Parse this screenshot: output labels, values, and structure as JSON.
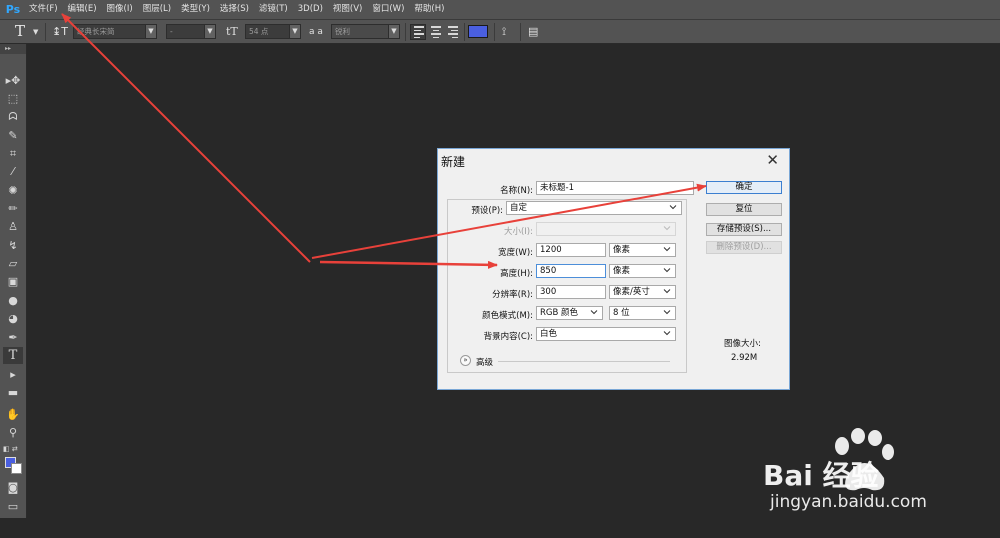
{
  "app": {
    "logo": "Ps"
  },
  "menu": [
    "文件(F)",
    "编辑(E)",
    "图像(I)",
    "图层(L)",
    "类型(Y)",
    "选择(S)",
    "滤镜(T)",
    "3D(D)",
    "视图(V)",
    "窗口(W)",
    "帮助(H)"
  ],
  "options": {
    "tool_glyph": "T",
    "font_family": "经典长宋简",
    "font_style": "-",
    "font_size": "54 点",
    "aa_label": "a a",
    "antialias": "锐利",
    "text_color": "#4a5fe0"
  },
  "tools": {
    "head": "▸▸",
    "foreground": "#4a5fe0",
    "background": "#ffffff"
  },
  "dialog": {
    "title": "新建",
    "name_label": "名称(N):",
    "name_value": "未标题-1",
    "preset_label": "预设(P):",
    "preset_value": "自定",
    "size_label": "大小(I):",
    "size_value": "",
    "width_label": "宽度(W):",
    "width_value": "1200",
    "width_unit": "像素",
    "height_label": "高度(H):",
    "height_value": "850",
    "height_unit": "像素",
    "res_label": "分辨率(R):",
    "res_value": "300",
    "res_unit": "像素/英寸",
    "mode_label": "颜色模式(M):",
    "mode_value": "RGB 颜色",
    "depth_value": "8 位",
    "bg_label": "背景内容(C):",
    "bg_value": "白色",
    "advanced_label": "高级",
    "btn_ok": "确定",
    "btn_reset": "复位",
    "btn_save": "存储预设(S)...",
    "btn_delete": "删除预设(D)...",
    "image_size_label": "图像大小:",
    "image_size_value": "2.92M"
  },
  "watermark": {
    "brand": "Bai  经验",
    "url": "jingyan.baidu.com"
  },
  "colors": {
    "arrow": "#e8413a",
    "accent": "#3c7fd0",
    "panel": "#535353",
    "workspace": "#282828"
  }
}
